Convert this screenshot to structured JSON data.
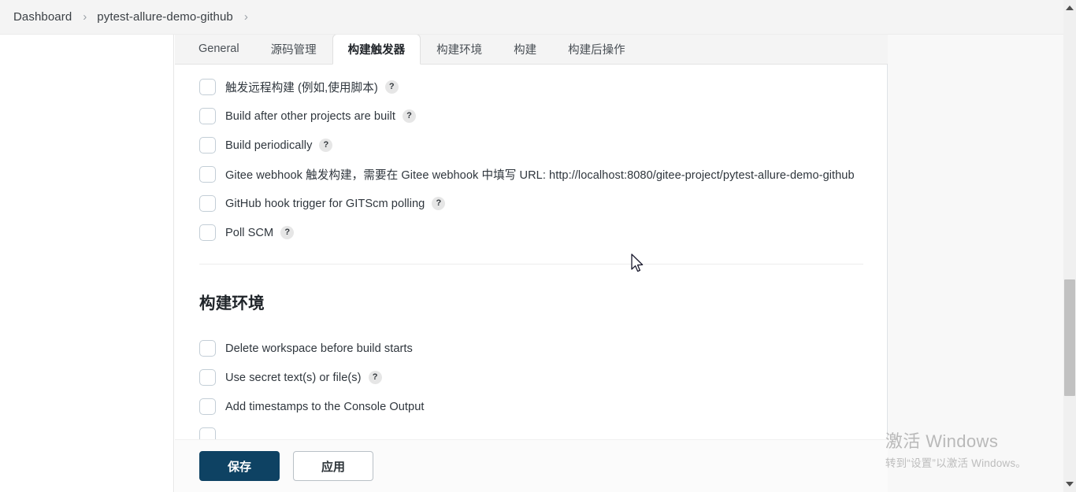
{
  "breadcrumb": {
    "items": [
      {
        "label": "Dashboard"
      },
      {
        "label": "pytest-allure-demo-github"
      }
    ],
    "separator": "›"
  },
  "tabs": [
    {
      "label": "General",
      "active": false
    },
    {
      "label": "源码管理",
      "active": false
    },
    {
      "label": "构建触发器",
      "active": true
    },
    {
      "label": "构建环境",
      "active": false
    },
    {
      "label": "构建",
      "active": false
    },
    {
      "label": "构建后操作",
      "active": false
    }
  ],
  "triggers": {
    "options": [
      {
        "label": "触发远程构建 (例如,使用脚本)",
        "checked": false,
        "help": "?"
      },
      {
        "label": "Build after other projects are built",
        "checked": false,
        "help": "?"
      },
      {
        "label": "Build periodically",
        "checked": false,
        "help": "?"
      },
      {
        "label": "Gitee webhook 触发构建，需要在 Gitee webhook 中填写 URL: http://localhost:8080/gitee-project/pytest-allure-demo-github",
        "checked": false,
        "help": ""
      },
      {
        "label": "GitHub hook trigger for GITScm polling",
        "checked": false,
        "help": "?"
      },
      {
        "label": "Poll SCM",
        "checked": false,
        "help": "?"
      }
    ]
  },
  "build_env": {
    "heading": "构建环境",
    "options": [
      {
        "label": "Delete workspace before build starts",
        "checked": false,
        "help": ""
      },
      {
        "label": "Use secret text(s) or file(s)",
        "checked": false,
        "help": "?"
      },
      {
        "label": "Add timestamps to the Console Output",
        "checked": false,
        "help": ""
      }
    ]
  },
  "footer": {
    "save_label": "保存",
    "apply_label": "应用"
  },
  "watermark": {
    "title": "激活 Windows",
    "subtitle": "转到“设置”以激活 Windows。"
  },
  "colors": {
    "primary_button": "#0e4263",
    "page_background": "#f8f8f8",
    "card_background": "#ffffff"
  }
}
